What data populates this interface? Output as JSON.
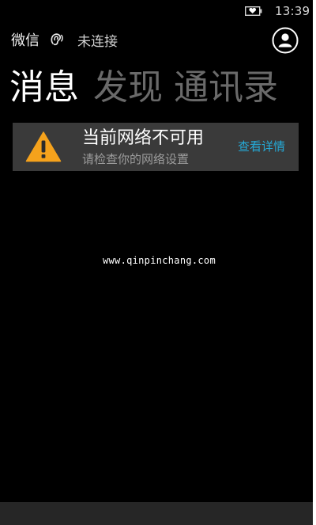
{
  "status_bar": {
    "time": "13:39",
    "battery_icon": "battery-heart-icon"
  },
  "header": {
    "app_name": "微信",
    "connection_icon": "ear-icon",
    "connection_status": "未连接",
    "profile_icon": "person-icon"
  },
  "pivot_tabs": [
    {
      "label": "消息",
      "active": true
    },
    {
      "label": "发现",
      "active": false
    },
    {
      "label": "通讯录",
      "active": false
    }
  ],
  "network_banner": {
    "icon": "warning-icon",
    "icon_color": "#f5a21c",
    "title": "当前网络不可用",
    "subtitle": "请检查你的网络设置",
    "action_label": "查看详情",
    "action_color": "#25a9d6"
  },
  "watermark": "www.qinpinchang.com",
  "colors": {
    "background": "#000000",
    "banner_bg": "#3a3a3a",
    "inactive_tab": "#6a6a6a"
  }
}
